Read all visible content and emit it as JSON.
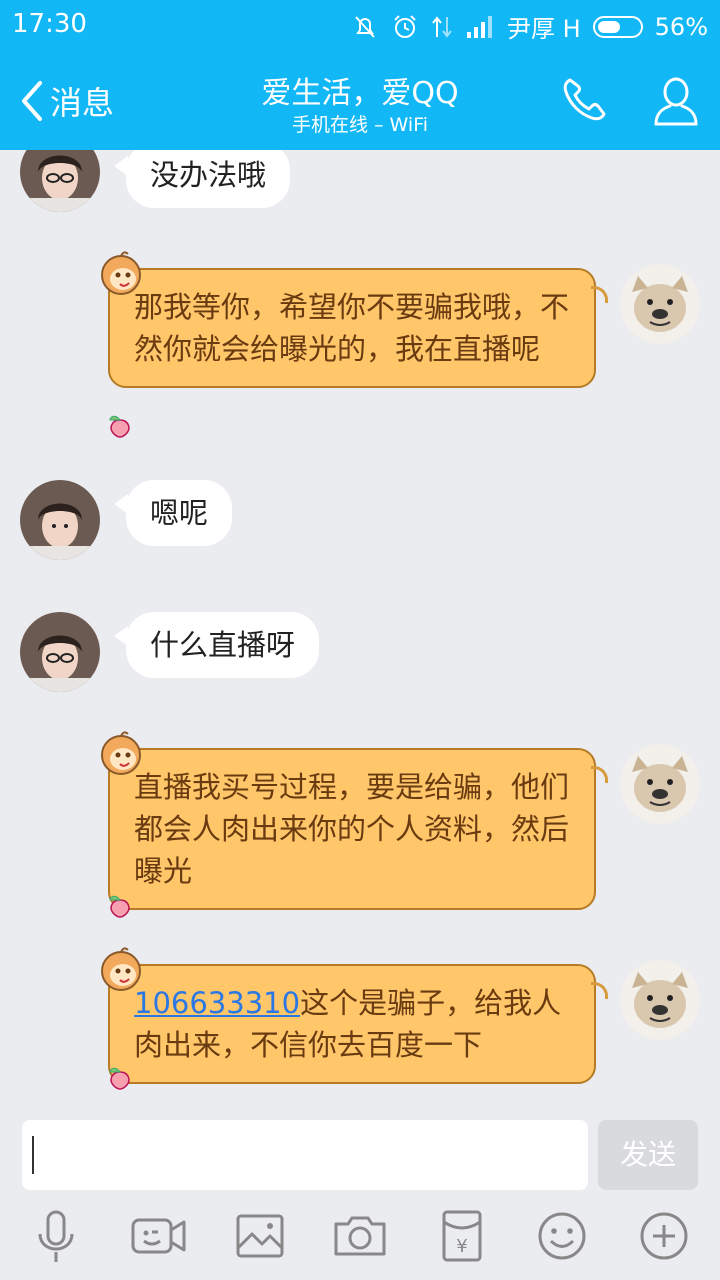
{
  "status_bar": {
    "time": "17:30",
    "carrier": "尹厚 H",
    "battery_percent": "56%",
    "battery_level": 0.56
  },
  "header": {
    "back_label": "消息",
    "title": "爱生活，爱QQ",
    "subtitle": "手机在线 – WiFi"
  },
  "messages": [
    {
      "side": "left",
      "text": "没办法哦"
    },
    {
      "side": "right",
      "text": "那我等你，希望你不要骗我哦，不然你就会给曝光的，我在直播呢"
    },
    {
      "side": "left",
      "text": "嗯呢"
    },
    {
      "side": "left",
      "text": "什么直播呀"
    },
    {
      "side": "right",
      "text": "直播我买号过程，要是给骗，他们都会人肉出来你的个人资料，然后曝光"
    },
    {
      "side": "right",
      "link": "106633310",
      "text": "这个是骗子，给我人肉出来，不信你去百度一下"
    }
  ],
  "input": {
    "value": "",
    "send_label": "发送"
  },
  "toolbar": [
    "mic-icon",
    "video-icon",
    "image-icon",
    "camera-icon",
    "red-packet-icon",
    "emoji-icon",
    "plus-icon"
  ],
  "colors": {
    "header_bg": "#12b7f5",
    "chat_bg": "#ebecf0",
    "my_bubble": "#ffc66a",
    "their_bubble": "#ffffff",
    "link": "#2b78e4"
  }
}
